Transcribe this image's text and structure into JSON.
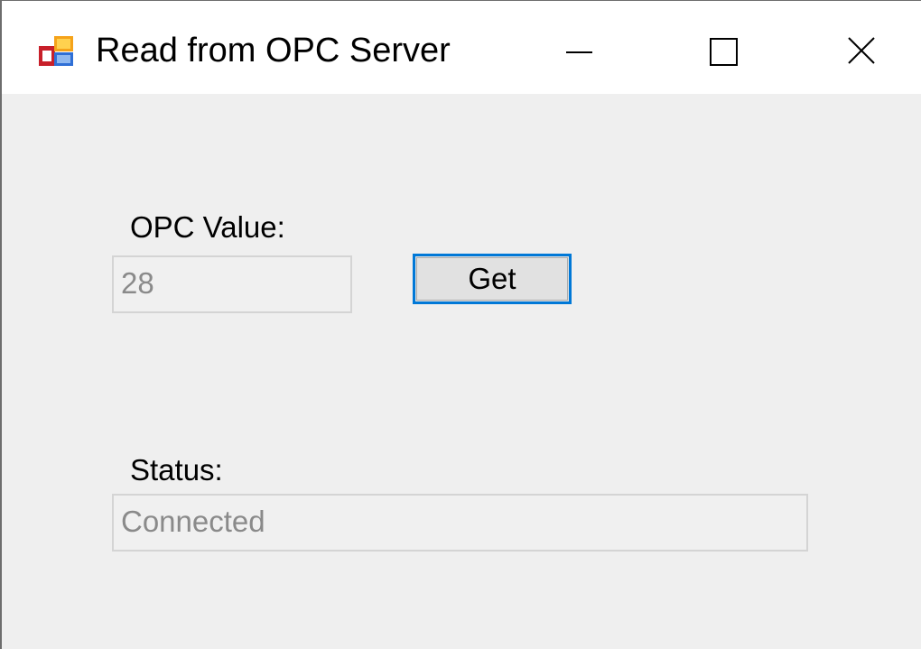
{
  "window": {
    "title": "Read from OPC Server",
    "icon": "app-window-icon",
    "controls": {
      "minimize_icon": "minimize-icon",
      "maximize_icon": "maximize-icon",
      "close_icon": "close-icon"
    }
  },
  "form": {
    "opc_value_label": "OPC Value:",
    "opc_value": "28",
    "get_button_label": "Get",
    "status_label": "Status:",
    "status_value": "Connected"
  },
  "colors": {
    "window_background": "#efefef",
    "titlebar_background": "#ffffff",
    "focus_accent": "#0078d7",
    "disabled_text": "#8a8a8a"
  }
}
